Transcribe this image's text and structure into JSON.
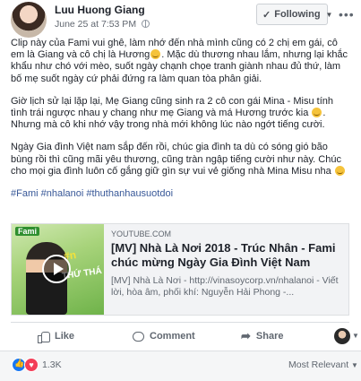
{
  "post": {
    "author": "Luu Huong Giang",
    "timestamp": "June 25 at 7:53 PM",
    "following_label": "Following",
    "paragraphs": [
      "Clip này của Fami vui ghê, làm nhớ đến nhà mình cũng có 2 chị em gái, cô em là Giang và cô chị là Hương",
      "Mặc dù thương nhau lắm, nhưng lại khắc khẩu như chó với mèo, suốt ngày chạnh chọe tranh giành nhau đủ thứ, làm bố mẹ suốt ngày cứ phải đứng ra làm quan tòa phân giải.",
      "Giờ lịch sử lại lặp lại, Mẹ Giang cũng sinh ra 2 cô con gái Mina - Misu tính tình trái ngược nhau y chang như mẹ Giang và má Hương trước kia",
      "Nhưng mà cô khi nhớ vậy trong nhà mới không lúc nào ngớt tiếng cười.",
      "Ngày Gia đình Việt nam sắp đến rồi, chúc gia đình ta dù có sóng gió bão bùng rồi thì cũng mãi yêu thương, cũng tràn ngập tiếng cười như này. Chúc cho mọi gia đình luôn cố gắng giữ gìn sự vui vẻ giống nhà Mina Misu nha"
    ],
    "hashtags": "#Fami #nhalanoi #thuthanhausuotdoi"
  },
  "link": {
    "thumb_logo": "Fami",
    "thumb_tag": "#n",
    "thumb_tag2": "THỨ THÁ",
    "domain": "YOUTUBE.COM",
    "title": "[MV] Nhà Là Nơi 2018 - Trúc Nhân - Fami chúc mừng Ngày Gia Đình Việt Nam",
    "description": "[MV] Nhà Là Nơi - http://vinasoycorp.vn/nhalanoi - Viết lời, hòa âm, phối khí: Nguyễn Hải Phong -..."
  },
  "actions": {
    "like": "Like",
    "comment": "Comment",
    "share": "Share"
  },
  "reactions": {
    "count": "1.3K",
    "sort_label": "Most Relevant"
  },
  "colors": {
    "link_blue": "#385898",
    "like_blue": "#1877f2",
    "love_red": "#f33e58"
  }
}
